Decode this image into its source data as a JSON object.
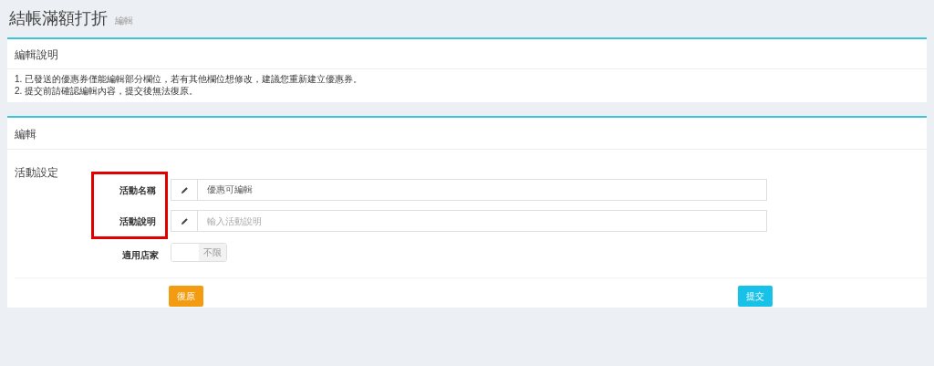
{
  "page": {
    "title": "結帳滿額打折",
    "subtitle": "編輯"
  },
  "notice_panel": {
    "title": "編輯說明",
    "lines": [
      "1. 已發送的優惠券僅能編輯部分欄位，若有其他欄位想修改，建議您重新建立優惠券。",
      "2. 提交前請確認編輯內容，提交後無法復原。"
    ]
  },
  "edit_panel": {
    "title": "編輯",
    "section": "活動設定",
    "fields": [
      {
        "kind": "text",
        "label": "活動名稱",
        "highlighted": true,
        "value": "優惠可編輯"
      },
      {
        "kind": "text",
        "label": "活動說明",
        "highlighted": true,
        "placeholder": "輸入活動說明"
      },
      {
        "kind": "switch",
        "label": "適用店家",
        "highlighted": false,
        "switch_label": "不限",
        "on": false
      }
    ],
    "buttons": [
      {
        "kind": "reset",
        "label": "復原"
      },
      {
        "kind": "submit",
        "label": "提交"
      }
    ]
  }
}
